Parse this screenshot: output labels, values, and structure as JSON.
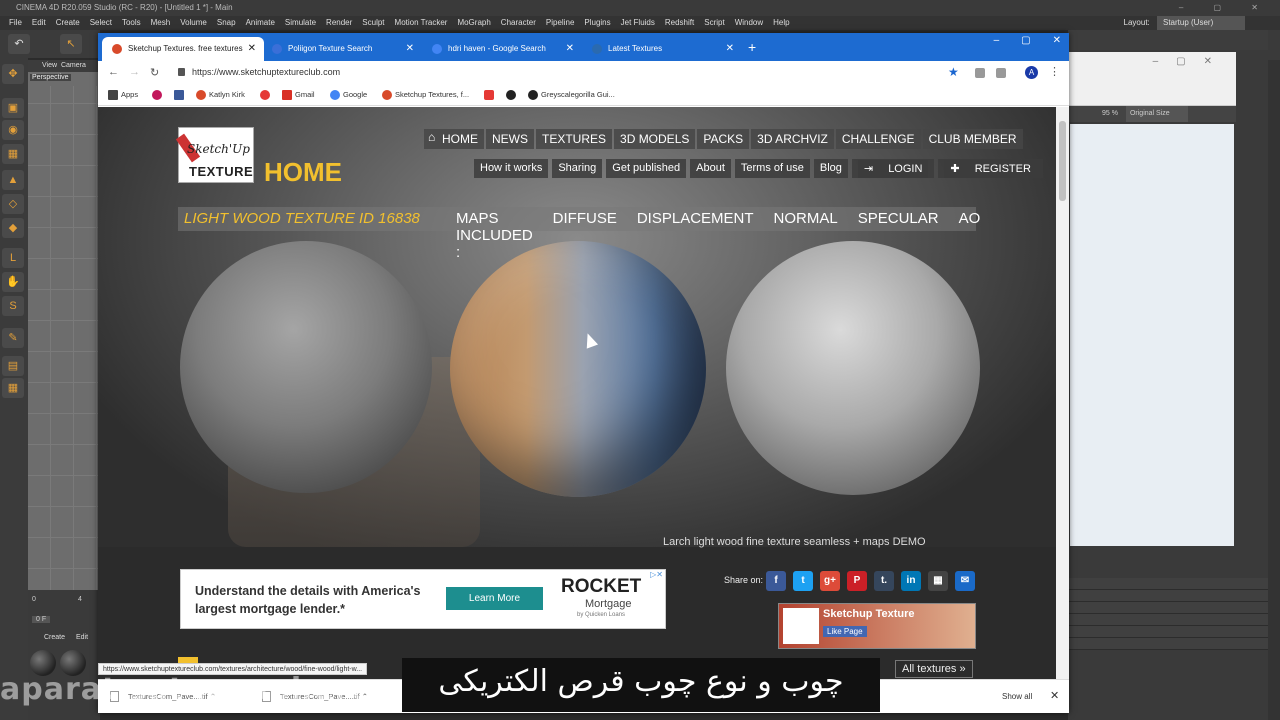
{
  "c4d": {
    "title": "CINEMA 4D R20.059 Studio (RC - R20) - [Untitled 1 *] - Main",
    "menu": [
      "File",
      "Edit",
      "Create",
      "Select",
      "Tools",
      "Mesh",
      "Volume",
      "Snap",
      "Animate",
      "Simulate",
      "Render",
      "Sculpt",
      "Motion Tracker",
      "MoGraph",
      "Character",
      "Pipeline",
      "Plugins",
      "Jet Fluids",
      "Redshift",
      "Script",
      "Window",
      "Help"
    ],
    "layout_label": "Layout:",
    "layout_value": "Startup (User)",
    "viewport_menu": [
      "View",
      "Camera"
    ],
    "viewport_name": "Perspective",
    "zoom": "95 %",
    "size_mode": "Original Size",
    "mat_menu": [
      "Create",
      "Edit"
    ],
    "timeline_start": "0",
    "timeline_end": "4",
    "frame_field": "0 F"
  },
  "browser": {
    "tabs": [
      {
        "label": "Sketchup Textures. free textures",
        "color": "#d84a2a"
      },
      {
        "label": "Poliigon Texture Search",
        "color": "#3a6fd8"
      },
      {
        "label": "hdri haven - Google Search",
        "color": "#4285f4"
      },
      {
        "label": "Latest Textures",
        "color": "#2a6ab0"
      }
    ],
    "url": "https://www.sketchuptextureclub.com",
    "bookmarks": [
      {
        "label": "Apps",
        "color": "#444"
      },
      {
        "label": "",
        "color": "#c2185b"
      },
      {
        "label": "",
        "color": "#3b5998"
      },
      {
        "label": "Katlyn Kirk",
        "color": "#d84a2a"
      },
      {
        "label": "",
        "color": "#e53935"
      },
      {
        "label": "Gmail",
        "color": "#d93025"
      },
      {
        "label": "Google",
        "color": "#4285f4"
      },
      {
        "label": "Sketchup Textures, f...",
        "color": "#d84a2a"
      },
      {
        "label": "",
        "color": "#e53935"
      },
      {
        "label": "",
        "color": "#222"
      },
      {
        "label": "Greyscalegorilla Gui...",
        "color": "#222"
      }
    ],
    "profile_initial": "A",
    "status_url": "https://www.sketchuptextureclub.com/textures/architecture/wood/fine-wood/light-w...",
    "downloads": [
      "TexturesCom_Pave....tif",
      "TexturesCom_Pave....tif"
    ],
    "show_all": "Show all"
  },
  "site": {
    "logo_line1": "Sketch'Up",
    "logo_line2": "TEXTURE",
    "home_word": "HOME",
    "main_nav": [
      "HOME",
      "NEWS",
      "TEXTURES",
      "3D MODELS",
      "PACKS",
      "3D ARCHVIZ",
      "CHALLENGE",
      "CLUB MEMBER"
    ],
    "sub_nav": [
      "How it works",
      "Sharing",
      "Get published",
      "About",
      "Terms of use",
      "Blog",
      "LOGIN",
      "REGISTER"
    ],
    "texture_title": "LIGHT WOOD TEXTURE  ID 16838",
    "maps": [
      "MAPS INCLUDED :",
      "DIFFUSE",
      "DISPLACEMENT",
      "NORMAL",
      "SPECULAR",
      "AO"
    ],
    "caption": "Larch light wood fine texture seamless + maps DEMO",
    "ad_text": "Understand the details with America's largest mortgage lender.*",
    "ad_button": "Learn More",
    "ad_brand": "ROCKET",
    "ad_brand_sub": "Mortgage",
    "ad_brand_by": "by Quicken Loans",
    "share_label": "Share on:",
    "social": [
      {
        "label": "f",
        "color": "#3b5998"
      },
      {
        "label": "t",
        "color": "#1da1f2"
      },
      {
        "label": "g+",
        "color": "#dd4b39"
      },
      {
        "label": "P",
        "color": "#cb2027"
      },
      {
        "label": "t.",
        "color": "#35465c"
      },
      {
        "label": "in",
        "color": "#0077b5"
      },
      {
        "label": "▦",
        "color": "#444"
      },
      {
        "label": "✉",
        "color": "#1a6ac8"
      }
    ],
    "fb_title": "Sketchup Texture",
    "fb_like": "Like Page",
    "all_textures": "All textures »"
  },
  "subtitle": "چوب و نوع چوب قرص الکتریکی",
  "watermark": "aparat sat mosphere"
}
